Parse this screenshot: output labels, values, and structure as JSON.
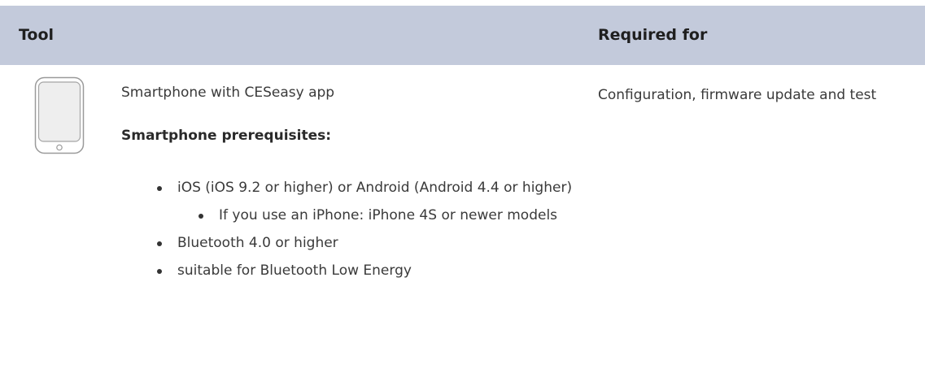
{
  "table": {
    "headers": {
      "tool": "Tool",
      "required_for": "Required for"
    },
    "rows": [
      {
        "icon": "smartphone-icon",
        "tool_name": "Smartphone with CESeasy app",
        "prereq_title": "Smartphone prerequisites:",
        "prerequisites": [
          "iOS (iOS 9.2 or higher) or Android (Android 4.4 or higher)",
          "If you use an iPhone: iPhone 4S or newer models",
          "Bluetooth 4.0 or higher",
          "suitable for Bluetooth Low Energy"
        ],
        "required_for": "Configuration, firmware update and test"
      }
    ]
  },
  "colors": {
    "header_background": "#c3cadb",
    "text": "#3a3a3a"
  }
}
